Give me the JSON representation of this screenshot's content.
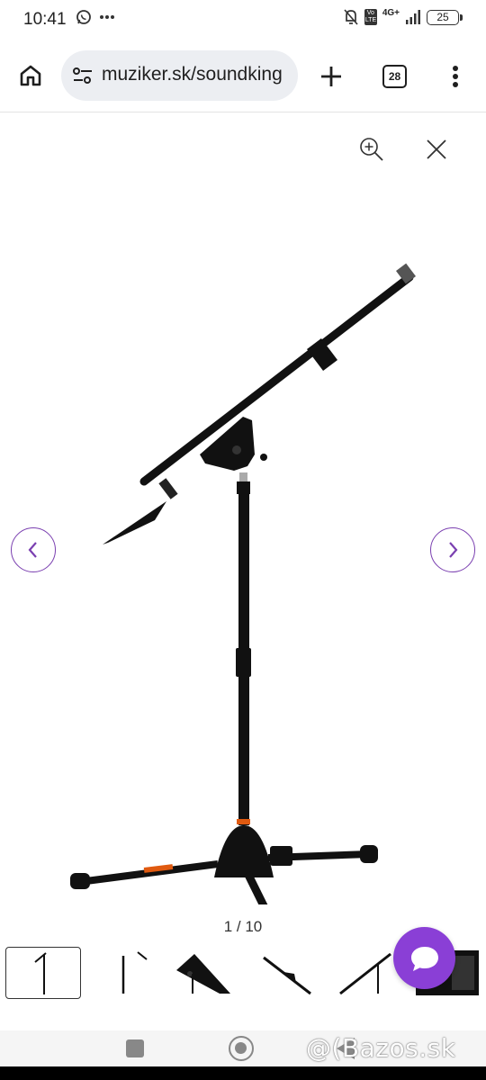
{
  "status_bar": {
    "time": "10:41",
    "network": "4G+",
    "volte": "Vo LTE",
    "battery": "25",
    "icons": [
      "whatsapp-icon",
      "more-dots-icon",
      "mute-bell-icon",
      "signal-icon",
      "battery-icon"
    ]
  },
  "browser": {
    "url": "muziker.sk/soundking",
    "tab_count": "28",
    "icons": [
      "home-icon",
      "tune-icon",
      "plus-icon",
      "tabs-icon",
      "overflow-menu-icon"
    ]
  },
  "gallery": {
    "counter": "1 / 10",
    "current_index": 1,
    "total": 10,
    "icons": [
      "zoom-in-icon",
      "close-icon",
      "chevron-left-icon",
      "chevron-right-icon"
    ],
    "accent_color": "#7a3fb0",
    "thumbnails": [
      "thumbnail-1",
      "thumbnail-2",
      "thumbnail-3",
      "thumbnail-4",
      "thumbnail-5",
      "thumbnail-6"
    ]
  },
  "chat": {
    "icon": "chat-bubble-icon",
    "color": "#8a3fd6"
  },
  "watermark": "@(Bazos.sk"
}
